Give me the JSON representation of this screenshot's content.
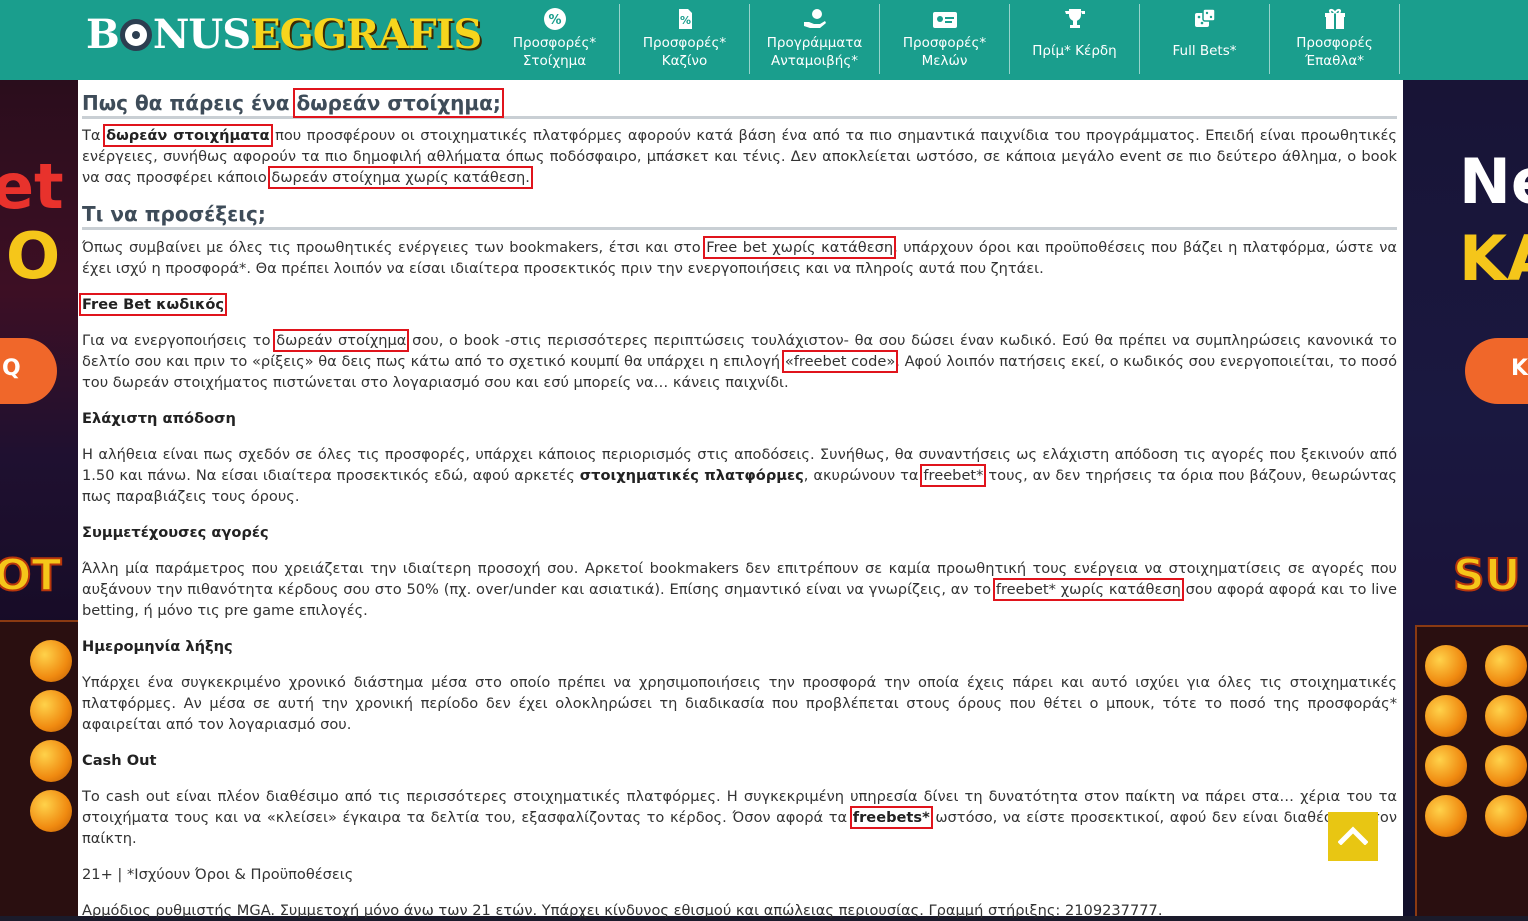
{
  "brand": {
    "logo_left": "B",
    "logo_mid": "NUS",
    "logo_right": "EGGRAFIS"
  },
  "nav": [
    {
      "icon": "percent-badge-icon",
      "label": "Προσφορές*\nΣτοίχημα"
    },
    {
      "icon": "casino-chip-icon",
      "label": "Προσφορές*\nΚαζίνο"
    },
    {
      "icon": "reward-hand-icon",
      "label": "Προγράμματα\nΑνταμοιβής*"
    },
    {
      "icon": "member-card-icon",
      "label": "Προσφορές*\nΜελών"
    },
    {
      "icon": "trophy-icon",
      "label": "Πρίμ* Κέρδη"
    },
    {
      "icon": "dice-icon",
      "label": "Full Bets*"
    },
    {
      "icon": "gift-icon",
      "label": "Προσφορές\nΈπαθλα*"
    }
  ],
  "side_banners": {
    "left": {
      "text1": "et",
      "text2": "IO",
      "cta": "Q",
      "slot": "OT"
    },
    "right": {
      "text1": "Ne",
      "text2": "KA",
      "cta": "K",
      "slot": "SU"
    }
  },
  "content": {
    "s1": {
      "heading_a": "Πως θα πάρεις ένα ",
      "heading_b": "δωρεάν στοίχημα;",
      "p_a": "Τα ",
      "p_b": "δωρεάν στοιχήματα",
      "p_c": " που προσφέρουν οι στοιχηματικές πλατφόρμες αφορούν κατά βάση ένα από τα πιο σημαντικά παιχνίδια του προγράμματος. Επειδή είναι προωθητικές ενέργειες, συνήθως αφορούν τα πιο δημοφιλή αθλήματα όπως ποδόσφαιρο, μπάσκετ και τένις. Δεν αποκλείεται ωστόσο, σε κάποια μεγάλο event σε πιο δεύτερο άθλημα, ο book να σας προσφέρει κάποιο ",
      "p_d": "δωρεάν στοίχημα χωρίς κατάθεση."
    },
    "s2": {
      "heading": "Τι να προσέξεις;",
      "p_a": "Όπως συμβαίνει με όλες τις προωθητικές ενέργειες των bookmakers, έτσι και στο ",
      "p_b": "Free bet χωρίς κατάθεση",
      "p_c": ", υπάρχουν όροι και προϋποθέσεις που βάζει η πλατφόρμα, ώστε να έχει ισχύ η προσφορά*. Θα πρέπει λοιπόν να είσαι ιδιαίτερα προσεκτικός πριν την ενεργοποιήσεις και να πληροίς αυτά που ζητάει."
    },
    "s3": {
      "heading": "Free Bet κωδικός",
      "p_a": "Για να ενεργοποιήσεις το ",
      "p_b": "δωρεάν στοίχημα",
      "p_c": " σου, ο book -στις περισσότερες περιπτώσεις τουλάχιστον- θα σου δώσει έναν κωδικό. Εσύ θα πρέπει να συμπληρώσεις κανονικά το δελτίο σου και πριν το «ρίξεις» θα δεις πως κάτω από το σχετικό κουμπί θα υπάρχει η επιλογή ",
      "p_d": "«freebet code»",
      "p_e": ". Αφού λοιπόν πατήσεις εκεί, ο κωδικός σου ενεργοποιείται, το ποσό του δωρεάν στοιχήματος πιστώνεται στο λογαριασμό σου και εσύ μπορείς να… κάνεις παιχνίδι."
    },
    "s4": {
      "heading": "Ελάχιστη απόδοση",
      "p_a": "Η αλήθεια είναι πως σχεδόν σε όλες τις προσφορές, υπάρχει κάποιος περιορισμός στις αποδόσεις. Συνήθως, θα συναντήσεις ως ελάχιστη απόδοση τις αγορές που ξεκινούν από 1.50 και πάνω. Να είσαι ιδιαίτερα προσεκτικός εδώ, αφού αρκετές ",
      "p_b": "στοιχηματικές πλατφόρμες",
      "p_c": ", ακυρώνουν τα ",
      "p_d": "freebet*",
      "p_e": " τους, αν δεν τηρήσεις τα όρια που βάζουν, θεωρώντας πως παραβιάζεις τους όρους."
    },
    "s5": {
      "heading": "Συμμετέχουσες αγορές",
      "p_a": "Άλλη μία παράμετρος που χρειάζεται την ιδιαίτερη προσοχή σου. Αρκετοί bookmakers δεν επιτρέπουν σε καμία προωθητική τους ενέργεια να στοιχηματίσεις σε αγορές που αυξάνουν την πιθανότητα κέρδους σου στο 50% (πχ. over/under και ασιατικά). Επίσης σημαντικό είναι να γνωρίζεις, αν το ",
      "p_b": "freebet* χωρίς κατάθεση",
      "p_c": " σου αφορά αφορά και το live betting, ή μόνο τις pre game επιλογές."
    },
    "s6": {
      "heading": "Ημερομηνία λήξης",
      "p": "Υπάρχει ένα συγκεκριμένο χρονικό διάστημα μέσα στο οποίο πρέπει να χρησιμοποιήσεις την προσφορά την οποία έχεις πάρει και αυτό ισχύει για όλες τις στοιχηματικές πλατφόρμες. Αν μέσα σε αυτή την χρονική περίοδο δεν έχει ολοκληρώσει τη διαδικασία που προβλέπεται στους όρους που θέτει ο μπουκ, τότε το ποσό της προσφοράς* αφαιρείται από τον λογαριασμό σου."
    },
    "s7": {
      "heading": "Cash Out",
      "p_a": "Το cash out είναι πλέον διαθέσιμο από τις περισσότερες στοιχηματικές πλατφόρμες. Η συγκεκριμένη υπηρεσία δίνει τη δυνατότητα στον παίκτη να πάρει στα… χέρια του τα στοιχήματα τους και να «κλείσει» έγκαιρα τα δελτία του, εξασφαλίζοντας το κέρδος. Όσον αφορά τα ",
      "p_b": "freebets*",
      "p_c": " ωστόσο, να είστε προσεκτικοί, αφού δεν είναι διαθέσιμο στον παίκτη."
    },
    "disclaimer": "21+ | *Ισχύουν Όροι & Προϋποθέσεις",
    "regulator": "Αρμόδιος ρυθμιστής MGA. Συμμετοχή μόνο άνω των 21 ετών. Υπάρχει κίνδυνος εθισμού και απώλειας περιουσίας. Γραμμή στήριξης: 2109237777."
  },
  "scroll_top": {
    "icon": "chevron-up-icon"
  },
  "colors": {
    "header": "#1a9e8d",
    "highlight": "#e0141c",
    "scroll_top": "#e8c613",
    "logo_accent": "#f7d51d"
  }
}
